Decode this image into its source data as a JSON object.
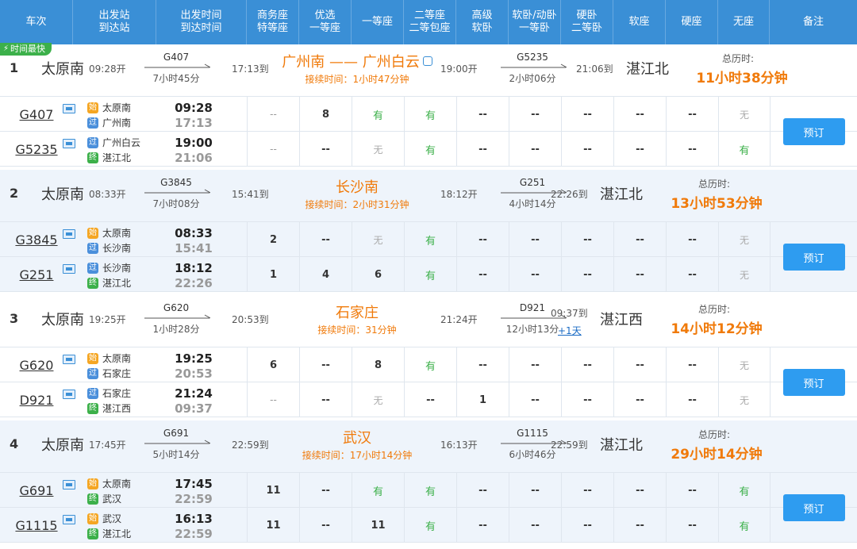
{
  "header": {
    "columns": [
      {
        "l1": "车次",
        "l2": ""
      },
      {
        "l1": "出发站",
        "l2": "到达站"
      },
      {
        "l1": "出发时间",
        "l2": "到达时间"
      },
      {
        "l1": "商务座",
        "l2": "特等座"
      },
      {
        "l1": "优选",
        "l2": "一等座"
      },
      {
        "l1": "一等座",
        "l2": ""
      },
      {
        "l1": "二等座",
        "l2": "二等包座"
      },
      {
        "l1": "高级",
        "l2": "软卧"
      },
      {
        "l1": "软卧/动卧",
        "l2": "一等卧"
      },
      {
        "l1": "硬卧",
        "l2": "二等卧"
      },
      {
        "l1": "软座",
        "l2": ""
      },
      {
        "l1": "硬座",
        "l2": ""
      },
      {
        "l1": "无座",
        "l2": ""
      },
      {
        "l1": "备注",
        "l2": ""
      }
    ]
  },
  "badge_label": "时间最快",
  "book_label": "预订",
  "total_label": "总历时:",
  "wait_prefix": "接续时间:",
  "colors": {
    "header": "#3a8fd6",
    "accent": "#f07a0a",
    "have": "#3cb04a",
    "button": "#2e9cf0"
  },
  "plans": [
    {
      "index": "1",
      "from": "太原南",
      "dep": "09:28开",
      "leg1": {
        "train": "G407",
        "dur": "7小时45分",
        "arr": "17:13到"
      },
      "transfer": "广州南 —— 广州白云",
      "wait": "接续时间：1小时47分钟",
      "leg2": {
        "train": "G5235",
        "dur": "2小时06分",
        "dep": "19:00开",
        "arr": "21:06到",
        "plus": ""
      },
      "to": "湛江北",
      "total": "11小时38分钟",
      "trains": [
        {
          "no": "G407",
          "s1tag": "始",
          "s1": "太原南",
          "s2tag": "过",
          "s2": "广州南",
          "t1": "09:28",
          "t2": "17:13",
          "seats": [
            "--",
            "8",
            "有",
            "有",
            "--",
            "--",
            "--",
            "--",
            "--",
            "无"
          ]
        },
        {
          "no": "G5235",
          "s1tag": "过",
          "s1": "广州白云",
          "s2tag": "终",
          "s2": "湛江北",
          "t1": "19:00",
          "t2": "21:06",
          "seats": [
            "--",
            "--",
            "无",
            "有",
            "--",
            "--",
            "--",
            "--",
            "--",
            "有"
          ]
        }
      ]
    },
    {
      "index": "2",
      "from": "太原南",
      "dep": "08:33开",
      "leg1": {
        "train": "G3845",
        "dur": "7小时08分",
        "arr": "15:41到"
      },
      "transfer": "长沙南",
      "wait": "接续时间：2小时31分钟",
      "leg2": {
        "train": "G251",
        "dur": "4小时14分",
        "dep": "18:12开",
        "arr": "22:26到",
        "plus": ""
      },
      "to": "湛江北",
      "total": "13小时53分钟",
      "trains": [
        {
          "no": "G3845",
          "s1tag": "始",
          "s1": "太原南",
          "s2tag": "过",
          "s2": "长沙南",
          "t1": "08:33",
          "t2": "15:41",
          "seats": [
            "2",
            "--",
            "无",
            "有",
            "--",
            "--",
            "--",
            "--",
            "--",
            "无"
          ]
        },
        {
          "no": "G251",
          "s1tag": "过",
          "s1": "长沙南",
          "s2tag": "终",
          "s2": "湛江北",
          "t1": "18:12",
          "t2": "22:26",
          "seats": [
            "1",
            "4",
            "6",
            "有",
            "--",
            "--",
            "--",
            "--",
            "--",
            "无"
          ]
        }
      ]
    },
    {
      "index": "3",
      "from": "太原南",
      "dep": "19:25开",
      "leg1": {
        "train": "G620",
        "dur": "1小时28分",
        "arr": "20:53到"
      },
      "transfer": "石家庄",
      "wait": "接续时间：31分钟",
      "leg2": {
        "train": "D921",
        "dur": "12小时13分",
        "dep": "21:24开",
        "arr": "09:37到",
        "plus": "+1天"
      },
      "to": "湛江西",
      "total": "14小时12分钟",
      "trains": [
        {
          "no": "G620",
          "s1tag": "始",
          "s1": "太原南",
          "s2tag": "过",
          "s2": "石家庄",
          "t1": "19:25",
          "t2": "20:53",
          "seats": [
            "6",
            "--",
            "8",
            "有",
            "--",
            "--",
            "--",
            "--",
            "--",
            "无"
          ]
        },
        {
          "no": "D921",
          "s1tag": "过",
          "s1": "石家庄",
          "s2tag": "终",
          "s2": "湛江西",
          "t1": "21:24",
          "t2": "09:37",
          "seats": [
            "--",
            "--",
            "无",
            "--",
            "1",
            "--",
            "--",
            "--",
            "--",
            "无"
          ]
        }
      ]
    },
    {
      "index": "4",
      "from": "太原南",
      "dep": "17:45开",
      "leg1": {
        "train": "G691",
        "dur": "5小时14分",
        "arr": "22:59到"
      },
      "transfer": "武汉",
      "wait": "接续时间：17小时14分钟",
      "leg2": {
        "train": "G1115",
        "dur": "6小时46分",
        "dep": "16:13开",
        "arr": "22:59到",
        "plus": ""
      },
      "to": "湛江北",
      "total": "29小时14分钟",
      "trains": [
        {
          "no": "G691",
          "s1tag": "始",
          "s1": "太原南",
          "s2tag": "终",
          "s2": "武汉",
          "t1": "17:45",
          "t2": "22:59",
          "seats": [
            "11",
            "--",
            "有",
            "有",
            "--",
            "--",
            "--",
            "--",
            "--",
            "有"
          ]
        },
        {
          "no": "G1115",
          "s1tag": "始",
          "s1": "武汉",
          "s2tag": "终",
          "s2": "湛江北",
          "t1": "16:13",
          "t2": "22:59",
          "seats": [
            "11",
            "--",
            "11",
            "有",
            "--",
            "--",
            "--",
            "--",
            "--",
            "有"
          ]
        }
      ]
    }
  ]
}
